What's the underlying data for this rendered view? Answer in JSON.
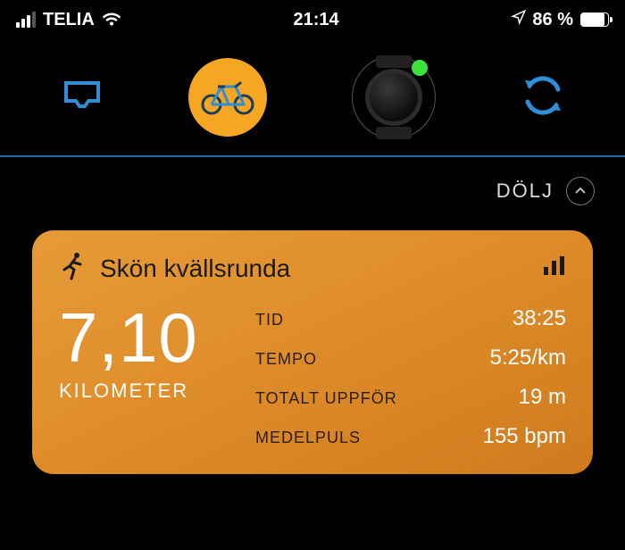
{
  "status": {
    "carrier": "TELIA",
    "time": "21:14",
    "battery_text": "86 %"
  },
  "hide_button": "DÖLJ",
  "activity": {
    "title": "Skön kvällsrunda",
    "distance_value": "7,10",
    "distance_unit": "KILOMETER",
    "stats": [
      {
        "label": "TID",
        "value": "38:25"
      },
      {
        "label": "TEMPO",
        "value": "5:25/km"
      },
      {
        "label": "TOTALT UPPFÖR",
        "value": "19 m"
      },
      {
        "label": "MEDELPULS",
        "value": "155 bpm"
      }
    ]
  }
}
